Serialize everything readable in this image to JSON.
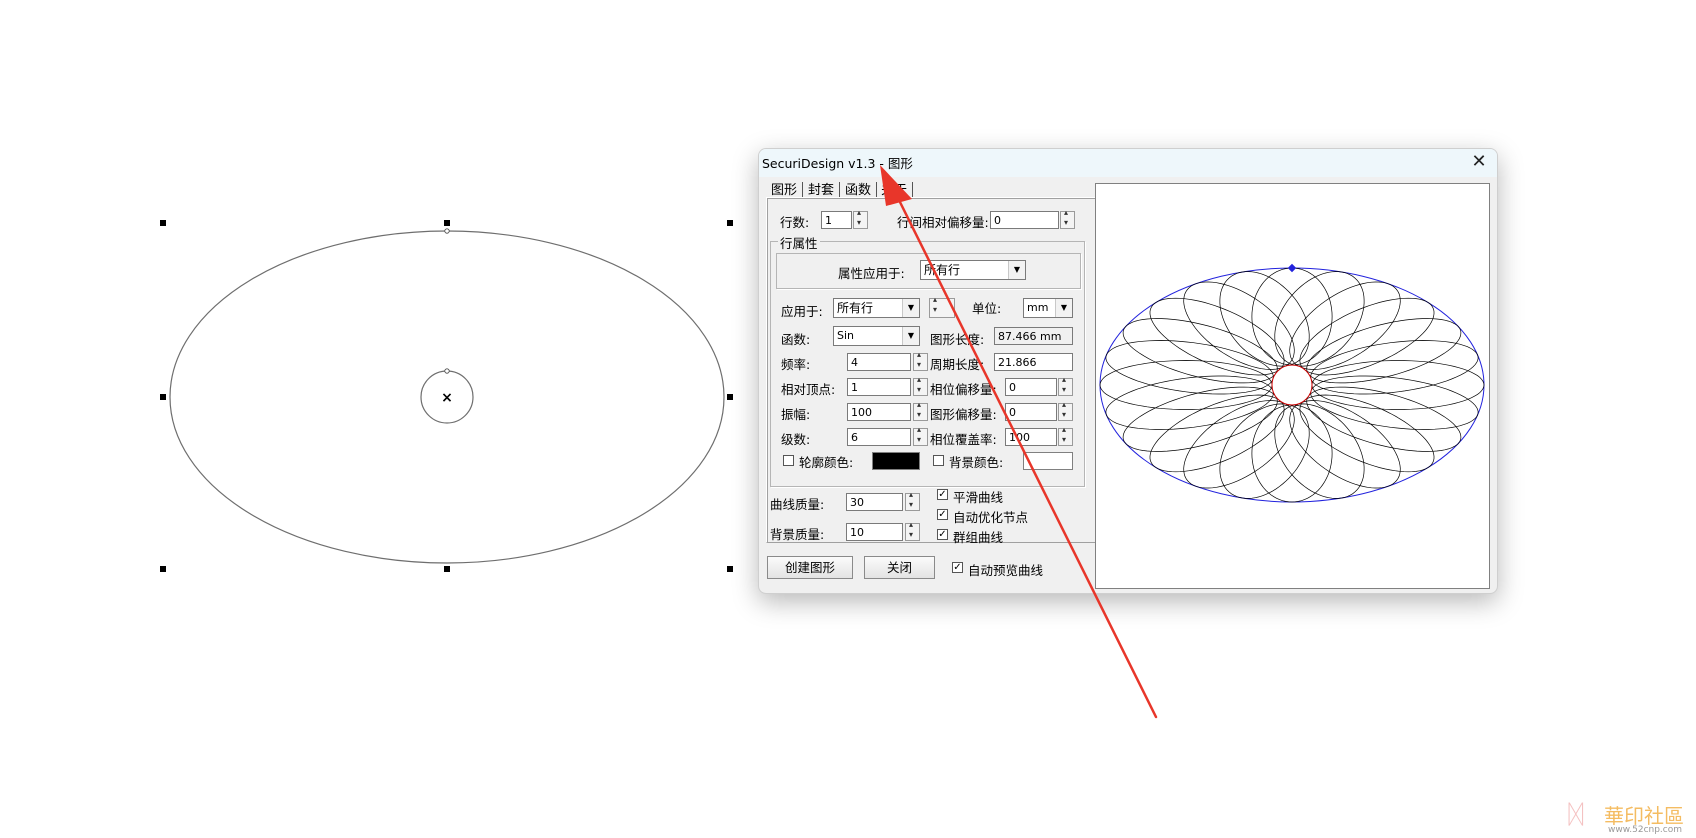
{
  "dialog": {
    "title": "SecuriDesign v1.3 - 图形",
    "close_glyph": "✕",
    "tabs": [
      {
        "label": "图形"
      },
      {
        "label": "封套"
      },
      {
        "label": "函数"
      },
      {
        "label": "关于"
      }
    ],
    "rows_label": "行数:",
    "rows_value": "1",
    "row_offset_label": "行间相对偏移量:",
    "row_offset_value": "0",
    "row_props_group": "行属性",
    "apply_props_label": "属性应用于:",
    "apply_props_value": "所有行",
    "apply_to_label": "应用于:",
    "apply_to_value": "所有行",
    "unit_label": "单位:",
    "unit_value": "mm",
    "function_label": "函数:",
    "function_value": "Sin",
    "shape_length_label": "图形长度:",
    "shape_length_value": "87.466 mm",
    "frequency_label": "频率:",
    "frequency_value": "4",
    "period_length_label": "周期长度:",
    "period_length_value": "21.866",
    "relative_vertex_label": "相对顶点:",
    "relative_vertex_value": "1",
    "phase_offset_label": "相位偏移量:",
    "phase_offset_value": "0",
    "amplitude_label": "振幅:",
    "amplitude_value": "100",
    "shape_offset_label": "图形偏移量:",
    "shape_offset_value": "0",
    "levels_label": "级数:",
    "levels_value": "6",
    "phase_coverage_label": "相位覆盖率:",
    "phase_coverage_value": "100",
    "outline_color_label": "轮廓颜色:",
    "outline_color": "#000000",
    "bg_color_label": "背景颜色:",
    "bg_color": "#ffffff",
    "curve_quality_label": "曲线质量:",
    "curve_quality_value": "30",
    "bg_quality_label": "背景质量:",
    "bg_quality_value": "10",
    "smooth_curve_label": "平滑曲线",
    "smooth_curve_checked": true,
    "auto_optimize_label": "自动优化节点",
    "auto_optimize_checked": true,
    "group_curves_label": "群组曲线",
    "group_curves_checked": true,
    "create_button": "创建图形",
    "close_button": "关闭",
    "auto_preview_label": "自动预览曲线",
    "auto_preview_checked": true,
    "check_glyph": "✓"
  },
  "canvas": {
    "center_marker": "×"
  },
  "watermark": {
    "brand": "華印社區",
    "url": "www.52cnp.com"
  },
  "colors": {
    "annotation_arrow": "#e8362a",
    "preview_outline": "#2222dd",
    "preview_curve": "#000000",
    "preview_inner": "#cc0000"
  }
}
